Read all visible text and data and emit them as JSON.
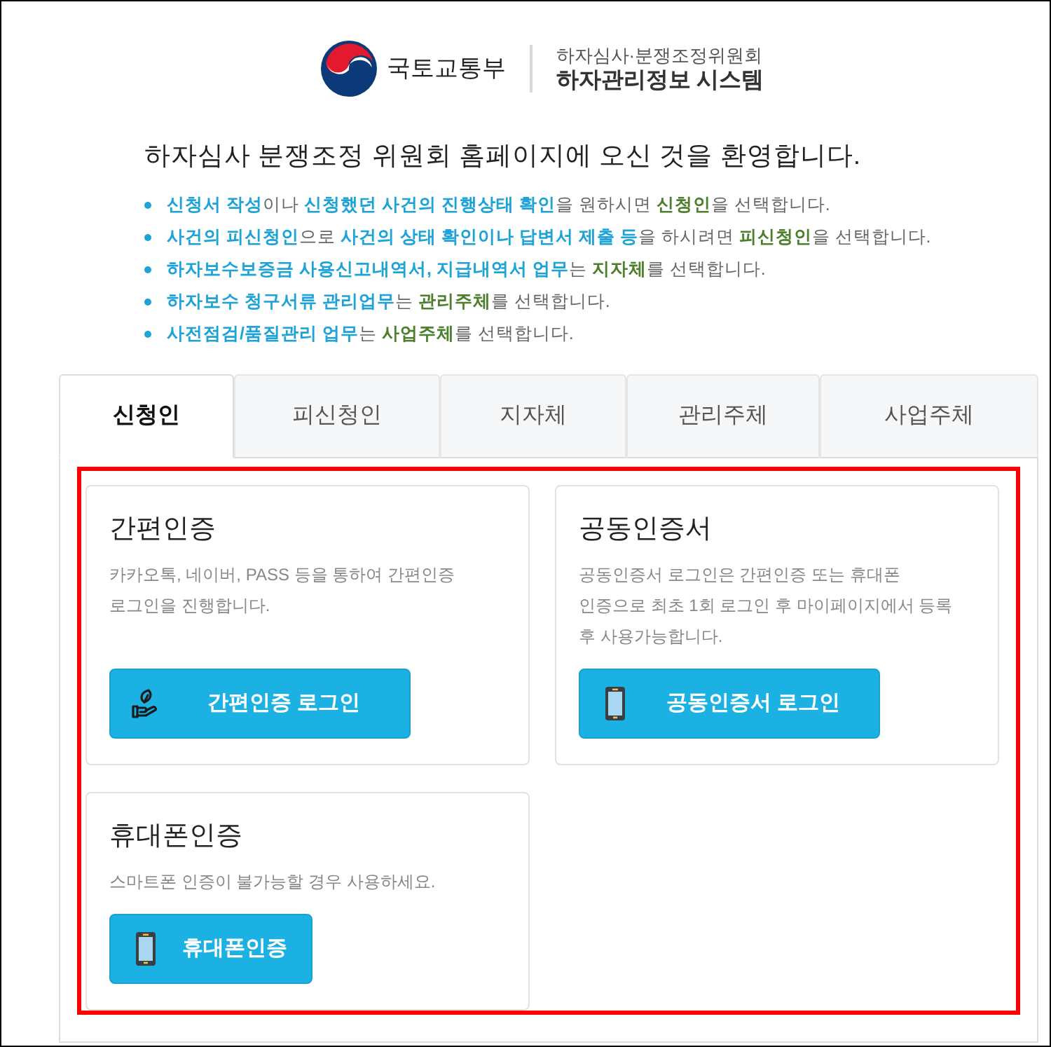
{
  "header": {
    "ministry": "국토교통부",
    "committee": "하자심사·분쟁조정위원회",
    "system": "하자관리정보 시스템"
  },
  "welcome": "하자심사 분쟁조정 위원회 홈페이지에 오신 것을 환영합니다.",
  "guide": [
    {
      "segments": [
        {
          "text": "신청서 작성",
          "kind": "task"
        },
        {
          "text": "이나 ",
          "kind": "plain"
        },
        {
          "text": "신청했던 사건의 진행상태 확인",
          "kind": "task"
        },
        {
          "text": "을 원하시면 ",
          "kind": "plain"
        },
        {
          "text": "신청인",
          "kind": "role"
        },
        {
          "text": "을 선택합니다.",
          "kind": "plain"
        }
      ]
    },
    {
      "segments": [
        {
          "text": "사건의 피신청인",
          "kind": "task"
        },
        {
          "text": "으로 ",
          "kind": "plain"
        },
        {
          "text": "사건의 상태 확인이나 답변서 제출 등",
          "kind": "task"
        },
        {
          "text": "을 하시려면 ",
          "kind": "plain"
        },
        {
          "text": "피신청인",
          "kind": "role"
        },
        {
          "text": "을 선택합니다.",
          "kind": "plain"
        }
      ]
    },
    {
      "segments": [
        {
          "text": "하자보수보증금 사용신고내역서, 지급내역서 업무",
          "kind": "task"
        },
        {
          "text": "는 ",
          "kind": "plain"
        },
        {
          "text": "지자체",
          "kind": "role"
        },
        {
          "text": "를 선택합니다.",
          "kind": "plain"
        }
      ]
    },
    {
      "segments": [
        {
          "text": "하자보수 청구서류 관리업무",
          "kind": "task"
        },
        {
          "text": "는 ",
          "kind": "plain"
        },
        {
          "text": "관리주체",
          "kind": "role"
        },
        {
          "text": "를 선택합니다.",
          "kind": "plain"
        }
      ]
    },
    {
      "segments": [
        {
          "text": "사전점검/품질관리 업무",
          "kind": "task"
        },
        {
          "text": "는 ",
          "kind": "plain"
        },
        {
          "text": "사업주체",
          "kind": "role"
        },
        {
          "text": "를 선택합니다.",
          "kind": "plain"
        }
      ]
    }
  ],
  "tabs": [
    {
      "label": "신청인",
      "selected": true
    },
    {
      "label": "피신청인",
      "selected": false
    },
    {
      "label": "지자체",
      "selected": false
    },
    {
      "label": "관리주체",
      "selected": false
    },
    {
      "label": "사업주체",
      "selected": false
    }
  ],
  "login_cards": [
    {
      "title": "간편인증",
      "description": "카카오톡, 네이버, PASS 등을 통하여 간편인증\n로그인을 진행합니다.",
      "button": {
        "label": "간편인증 로그인",
        "kind": "hand"
      }
    },
    {
      "title": "공동인증서",
      "description": "공동인증서 로그인은 간편인증 또는 휴대폰\n인증으로 최초 1회 로그인 후 마이페이지에서 등록\n후 사용가능합니다.",
      "button": {
        "label": "공동인증서 로그인",
        "kind": "phone"
      }
    },
    {
      "title": "휴대폰인증",
      "description": "스마트폰 인증이 불가능할 경우 사용하세요.",
      "button": {
        "label": "휴대폰인증",
        "kind": "phone"
      }
    }
  ]
}
